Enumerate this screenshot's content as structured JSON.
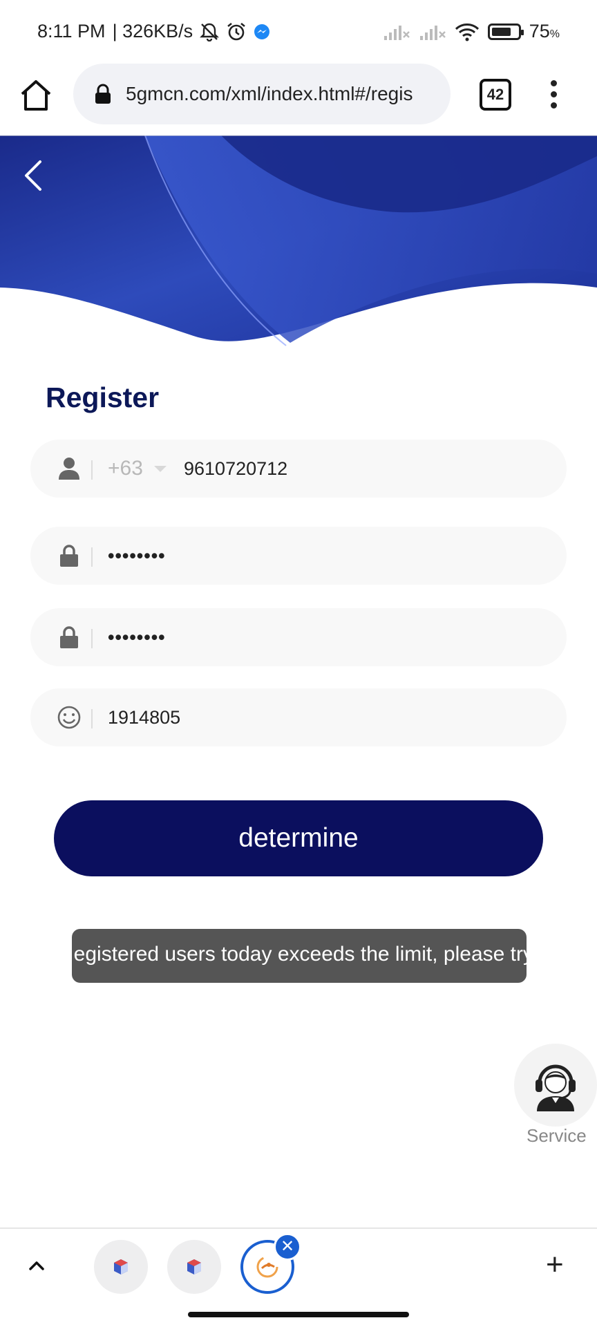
{
  "status_bar": {
    "time": "8:11 PM",
    "speed": "| 326KB/s",
    "battery_percent": "75",
    "battery_unit": "%",
    "battery_level": 0.75
  },
  "browser": {
    "url": "5gmcn.com/xml/index.html#/regis",
    "tab_count": "42"
  },
  "page": {
    "title": "Register",
    "phone_code": "+63",
    "phone": "9610720712",
    "password": "••••••••",
    "confirm_password": "••••••••",
    "invite_code": "1914805",
    "submit_label": "determine",
    "toast": "egistered users today exceeds the limit, please try",
    "service_label": "Service"
  },
  "tab_strip": {
    "close_glyph": "✕",
    "plus_glyph": "+"
  },
  "colors": {
    "brand_navy": "#0b0f5e",
    "title_navy": "#0c1858",
    "banner_blue": "#2a46b0",
    "active_tab_blue": "#1a5fd0"
  }
}
